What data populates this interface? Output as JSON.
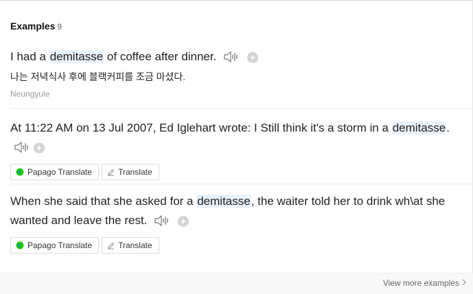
{
  "header": {
    "title": "Examples",
    "count": "9"
  },
  "examples": [
    {
      "pre": "I had a ",
      "highlight": "demitasse",
      "post": " of coffee after dinner.",
      "translation": "나는 저녁식사 후에 블랙커피를 조금 마셨다.",
      "source": "Neungyule"
    },
    {
      "pre": "At 11:22 AM on 13 Jul 2007, Ed Iglehart wrote: I Still think it's a storm in a ",
      "highlight": "demitasse",
      "post": ".",
      "papago_label": "Papago Translate",
      "translate_label": "Translate"
    },
    {
      "pre": "When she said that she asked for a ",
      "highlight": "demitasse",
      "post": ", the waiter told her to drink wh\\at she wanted and leave the rest.",
      "papago_label": "Papago Translate",
      "translate_label": "Translate"
    }
  ],
  "footer": {
    "more_label": "View more examples"
  },
  "colors": {
    "highlight": "#e8f2fb",
    "papago_green": "#1ec800",
    "papago_blue": "#1e88e5"
  },
  "icons": [
    "speaker-icon",
    "plus-circle-icon",
    "papago-logo-icon",
    "pencil-icon",
    "chevron-right-icon"
  ]
}
